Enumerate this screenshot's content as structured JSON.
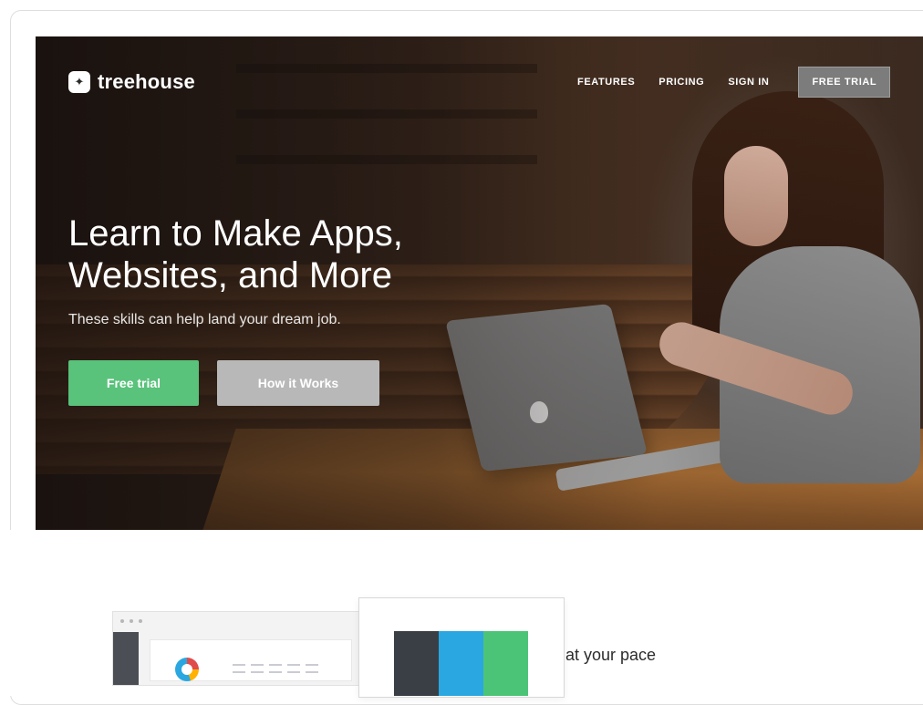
{
  "brand": {
    "name": "treehouse"
  },
  "nav": {
    "features": "FEATURES",
    "pricing": "PRICING",
    "sign_in": "SIGN IN",
    "free_trial": "FREE TRIAL"
  },
  "hero": {
    "headline_line1": "Learn to Make Apps,",
    "headline_line2": "Websites, and More",
    "subtext": "These skills can help land your dream job.",
    "primary_cta": "Free trial",
    "secondary_cta": "How it Works"
  },
  "features": {
    "pace_text": "at your pace",
    "palette_colors": [
      "#3a3f45",
      "#2aa7e0",
      "#4cc477"
    ]
  },
  "icons": {
    "logo": "treehouse-logo-icon",
    "apple": "apple-logo-icon",
    "donut": "donut-chart-icon"
  },
  "colors": {
    "accent_green": "#59c27b",
    "secondary_gray": "#b8b8b8",
    "nav_trial_bg": "#7c7c7c"
  }
}
